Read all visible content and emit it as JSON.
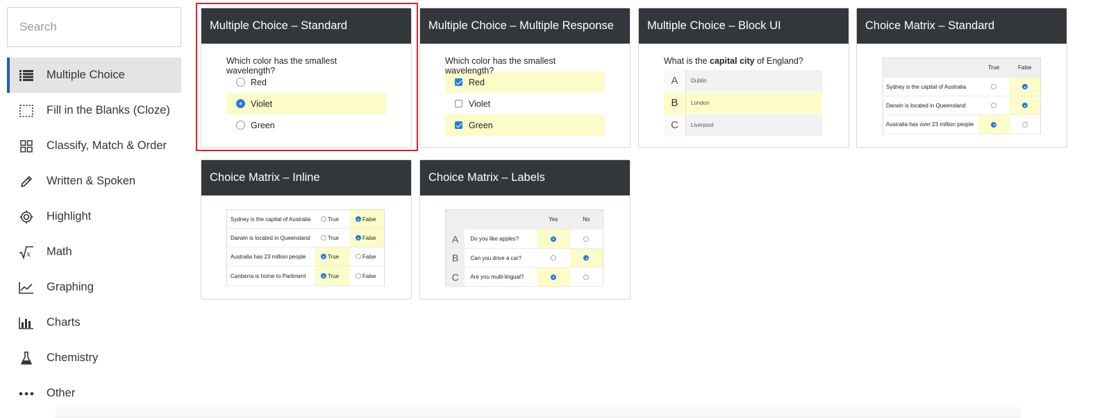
{
  "search": {
    "placeholder": "Search"
  },
  "sidebar": {
    "items": [
      {
        "label": "Multiple Choice",
        "icon": "list-icon",
        "active": true
      },
      {
        "label": "Fill in the Blanks (Cloze)",
        "icon": "dashed-box-icon"
      },
      {
        "label": "Classify, Match & Order",
        "icon": "grid-icon"
      },
      {
        "label": "Written & Spoken",
        "icon": "pencil-icon"
      },
      {
        "label": "Highlight",
        "icon": "target-icon"
      },
      {
        "label": "Math",
        "icon": "sqrt-icon"
      },
      {
        "label": "Graphing",
        "icon": "line-chart-icon"
      },
      {
        "label": "Charts",
        "icon": "bar-chart-icon"
      },
      {
        "label": "Chemistry",
        "icon": "flask-icon"
      },
      {
        "label": "Other",
        "icon": "more-dots-icon"
      }
    ]
  },
  "cards": {
    "mc_standard": {
      "title": "Multiple Choice – Standard",
      "question": "Which color has the smallest wavelength?",
      "options": [
        "Red",
        "Violet",
        "Green"
      ]
    },
    "mc_multi": {
      "title": "Multiple Choice – Multiple Response",
      "question": "Which color has the smallest wavelength?",
      "options": [
        "Red",
        "Violet",
        "Green"
      ]
    },
    "mc_block": {
      "title": "Multiple Choice – Block UI",
      "question_pre": "What is the ",
      "question_bold": "capital city",
      "question_post": " of England?",
      "letters": [
        "A",
        "B",
        "C"
      ],
      "options": [
        "Dublin",
        "London",
        "Liverpool"
      ]
    },
    "matrix_standard": {
      "title": "Choice Matrix – Standard",
      "col_true": "True",
      "col_false": "False",
      "rows": [
        "Sydney is the capital of Australia",
        "Darwin is located in Queensland",
        "Australia has over 23 million people"
      ]
    },
    "matrix_inline": {
      "title": "Choice Matrix – Inline",
      "true_label": "True",
      "false_label": "False",
      "rows": [
        "Sydney is the capital of Australia",
        "Darwin is located in Queensland",
        "Australia has 23 million people",
        "Canberra is home to Parliment"
      ]
    },
    "matrix_labels": {
      "title": "Choice Matrix – Labels",
      "col_yes": "Yes",
      "col_no": "No",
      "letters": [
        "A",
        "B",
        "C"
      ],
      "rows": [
        "Do you like apples?",
        "Can you drive a car?",
        "Are you multi-lingual?"
      ]
    }
  },
  "colors": {
    "accent": "#1c5bbf",
    "header": "#33363b",
    "highlight": "#fbfcc8",
    "selection": "#e21f26",
    "radio": "#2a7ae2"
  }
}
